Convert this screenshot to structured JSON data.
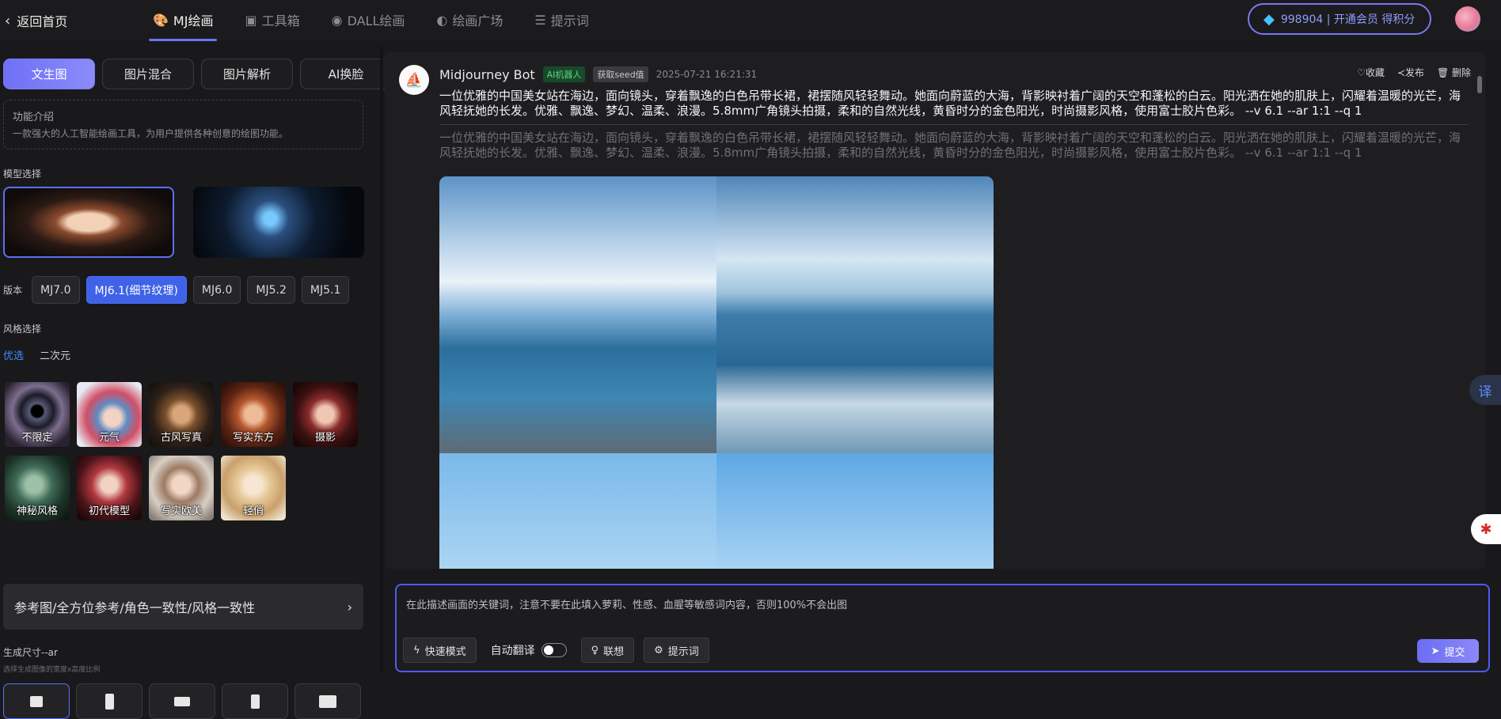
{
  "header": {
    "back_label": "返回首页",
    "tabs": [
      {
        "label": "MJ绘画",
        "icon": "palette-icon",
        "active": true
      },
      {
        "label": "工具箱",
        "icon": "toolbox-icon",
        "active": false
      },
      {
        "label": "DALL绘画",
        "icon": "palette-icon",
        "active": false
      },
      {
        "label": "绘画广场",
        "icon": "planet-icon",
        "active": false
      },
      {
        "label": "提示词",
        "icon": "prompt-icon",
        "active": false
      }
    ],
    "vip_text": "998904 | 开通会员 得积分"
  },
  "sidebar": {
    "mode_tabs": [
      "文生图",
      "图片混合",
      "图片解析",
      "AI换脸"
    ],
    "intro_title": "功能介绍",
    "intro_desc": "一款强大的人工智能绘画工具，为用户提供各种创意的绘图功能。",
    "model_label": "模型选择",
    "version_label": "版本",
    "versions": [
      "MJ7.0",
      "MJ6.1(细节纹理)",
      "MJ6.0",
      "MJ5.2",
      "MJ5.1"
    ],
    "active_version": 1,
    "style_label": "风格选择",
    "style_cats": [
      "优选",
      "二次元"
    ],
    "styles": [
      "不限定",
      "元气",
      "古风写真",
      "写实东方",
      "摄影",
      "神秘风格",
      "初代模型",
      "写实欧美",
      "轻俏"
    ],
    "ref_label": "参考图/全方位参考/角色一致性/风格一致性",
    "size_label": "生成尺寸--ar",
    "size_hint": "选择生成图像的宽度x高度比例"
  },
  "message": {
    "bot_name": "Midjourney Bot",
    "badge_ai": "AI机器人",
    "badge_seed": "获取seed值",
    "time": "2025-07-21 16:21:31",
    "actions": [
      "♡收藏",
      "≺发布",
      "🗑 删除"
    ],
    "prompt": "一位优雅的中国美女站在海边，面向镜头，穿着飘逸的白色吊带长裙，裙摆随风轻轻舞动。她面向蔚蓝的大海，背影映衬着广阔的天空和蓬松的白云。阳光洒在她的肌肤上，闪耀着温暖的光芒，海风轻抚她的长发。优雅、飘逸、梦幻、温柔、浪漫。5.8mm广角镜头拍摄，柔和的自然光线，黄昏时分的金色阳光，时尚摄影风格，使用富士胶片色彩。 --v 6.1 --ar 1:1 --q 1",
    "prompt_echo": "一位优雅的中国美女站在海边，面向镜头，穿着飘逸的白色吊带长裙，裙摆随风轻轻舞动。她面向蔚蓝的大海，背影映衬着广阔的天空和蓬松的白云。阳光洒在她的肌肤上，闪耀着温暖的光芒，海风轻抚她的长发。优雅、飘逸、梦幻、温柔、浪漫。5.8mm广角镜头拍摄，柔和的自然光线，黄昏时分的金色阳光，时尚摄影风格，使用富士胶片色彩。 --v 6.1 --ar 1:1 --q 1"
  },
  "side_float": {
    "translate": "译"
  },
  "input": {
    "placeholder": "在此描述画面的关键词，注意不要在此填入萝莉、性感、血腥等敏感词内容，否则100%不会出图",
    "fast_mode": "快速模式",
    "auto_translate": "自动翻译",
    "associate": "联想",
    "prompt_btn": "提示词",
    "submit": "提交"
  },
  "colors": {
    "accent": "#6b74f5",
    "active_version": "#3f62e8",
    "vip_text": "#8e9cff"
  }
}
